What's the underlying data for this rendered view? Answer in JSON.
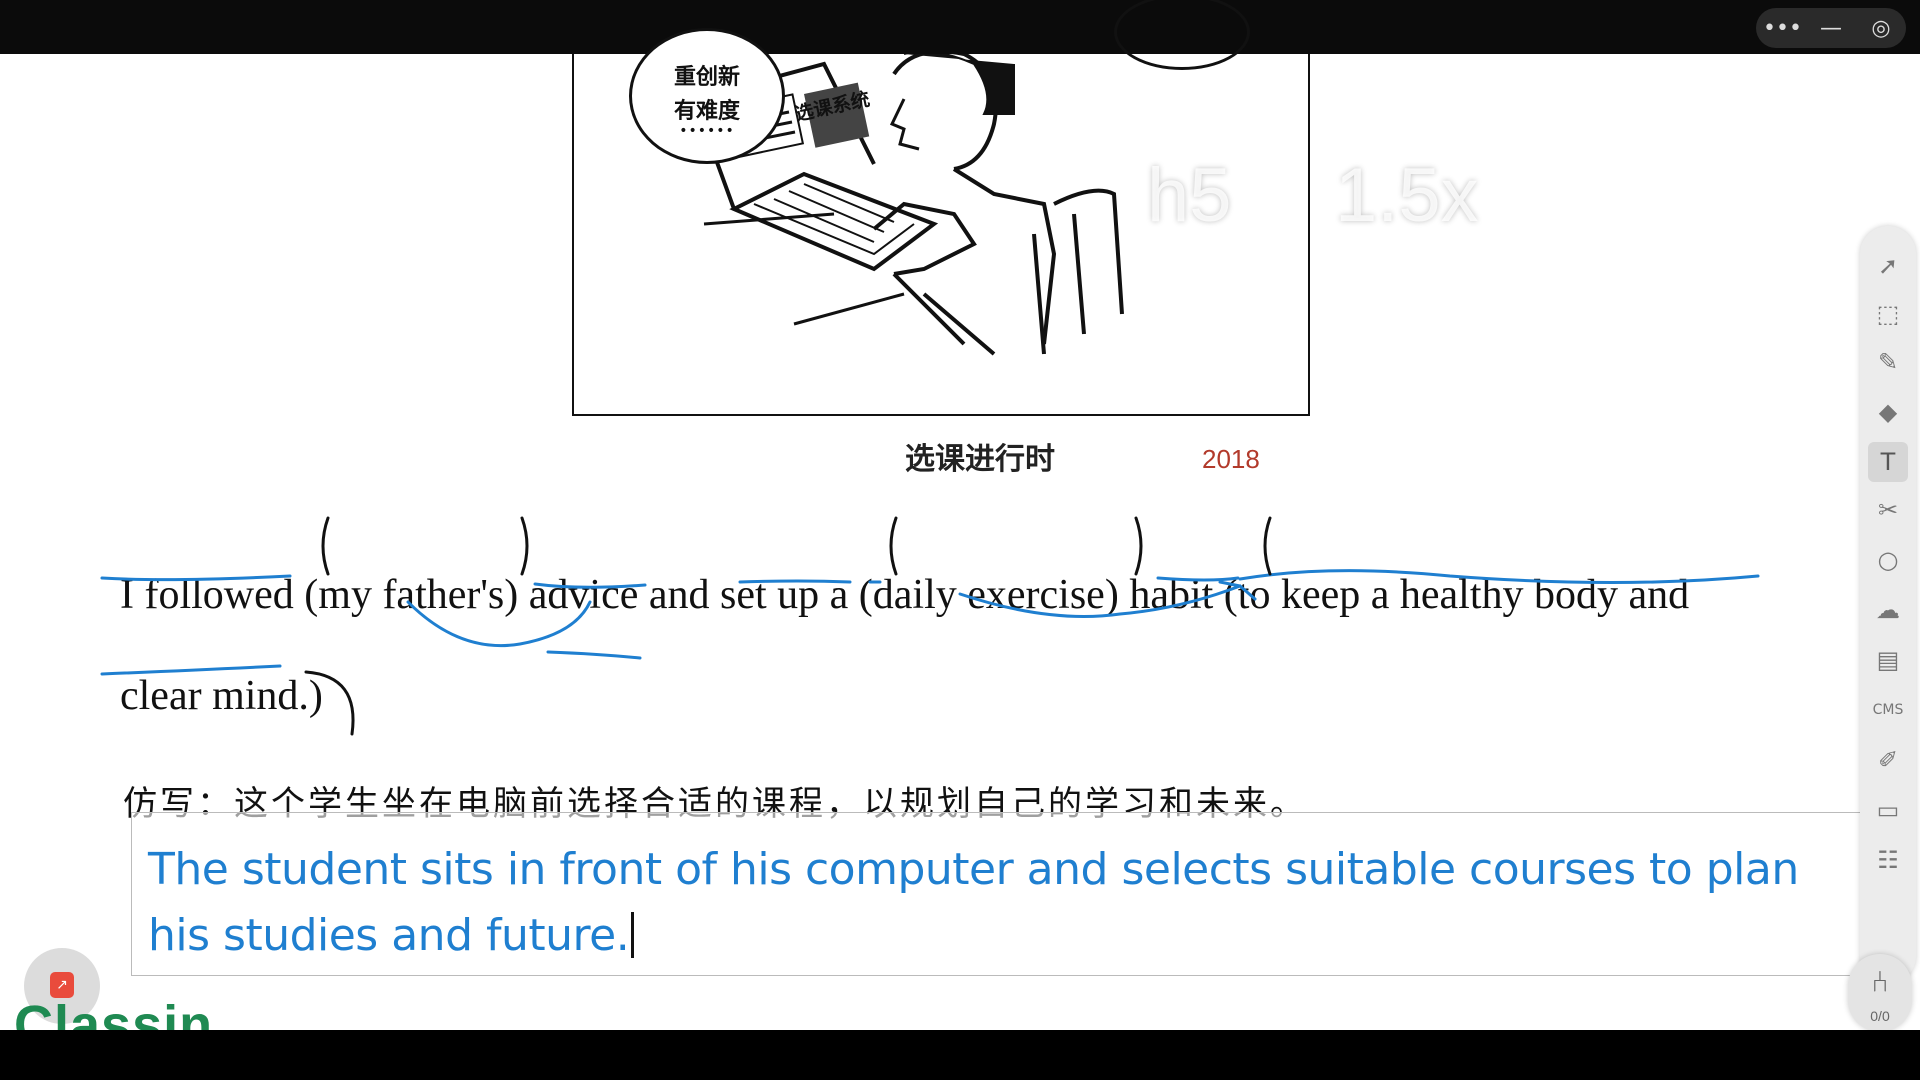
{
  "window": {
    "controls": [
      "•••",
      "—",
      "◎"
    ]
  },
  "illustration": {
    "bubble_line1": "重创新",
    "bubble_line2": "有难度",
    "bubble_dots": "••••••",
    "screen_label": "选课系统",
    "caption": "选课进行时",
    "year": "2018"
  },
  "overlay": {
    "format": "h5",
    "speed": "1.5x",
    "replay_icon": "replay-icon"
  },
  "sentence": {
    "line1": "I followed (my father's) advice and set up a (daily exercise) habit (to keep a healthy body and",
    "line2": "clear mind.)"
  },
  "task": {
    "label": "仿写：这个学生坐在电脑前选择合适的课程，以规划自己的学习和未来。",
    "answer": "The student sits in front of his computer and selects suitable courses to plan his studies and future."
  },
  "annotation_color": "#1f7fd0",
  "toolbar": {
    "tools": [
      "pointer-icon",
      "marquee-select-icon",
      "pen-icon",
      "eraser-icon",
      "text-icon",
      "scissors-icon",
      "shape-icon",
      "cloud-icon",
      "toolbox-icon",
      "cms-icon",
      "edit-icon",
      "chat-icon",
      "users-icon"
    ],
    "cms_label": "CMS"
  },
  "seat": {
    "count": "0/0"
  },
  "brand": {
    "logo": "Classin"
  }
}
